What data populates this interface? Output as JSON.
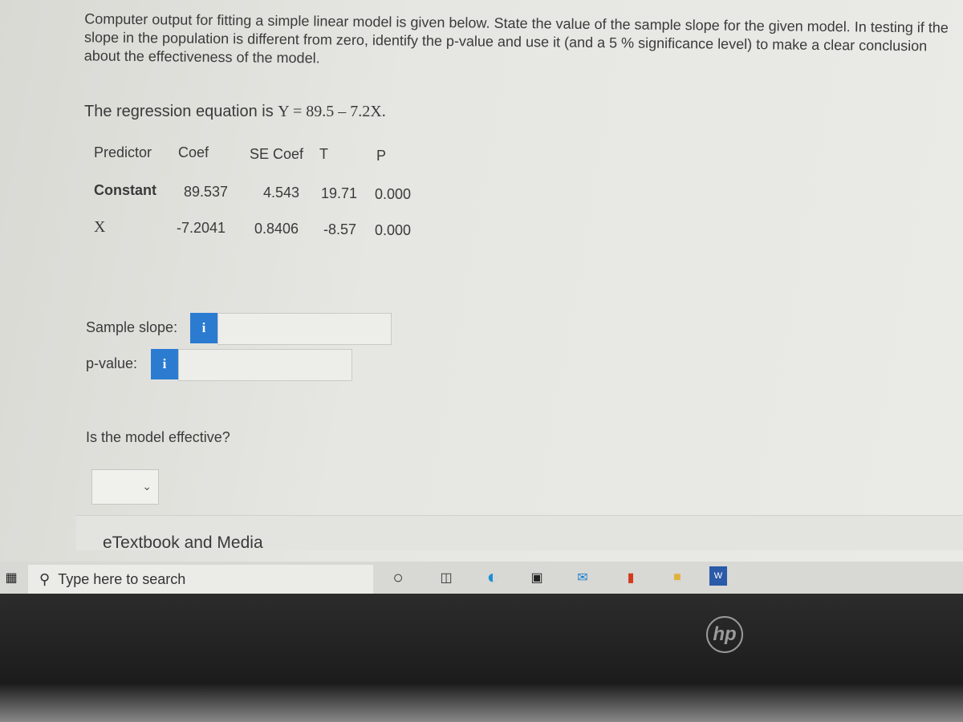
{
  "question": "Computer output for fitting a simple linear model is given below. State the value of the sample slope for the given model. In testing if the slope in the population is different from zero, identify the p-value and use it (and a 5 % significance level) to make a clear conclusion about the effectiveness of the model.",
  "equation": {
    "prefix": "The regression equation is",
    "formula": "Y = 89.5 – 7.2X."
  },
  "table": {
    "headers": [
      "Predictor",
      "Coef",
      "SE Coef",
      "T",
      "P"
    ],
    "rows": [
      [
        "Constant",
        "89.537",
        "4.543",
        "19.71",
        "0.000"
      ],
      [
        "X",
        "-7.2041",
        "0.8406",
        "-8.57",
        "0.000"
      ]
    ]
  },
  "sample_slope": {
    "label": "Sample slope:",
    "value": ""
  },
  "p_value": {
    "label": "p-value:",
    "value": ""
  },
  "info_icon": "i",
  "effective": {
    "label": "Is the model effective?",
    "selected": ""
  },
  "etextbook": "eTextbook and Media",
  "taskbar": {
    "search_placeholder": "Type here to search",
    "word_label": "W"
  },
  "brand": "hp",
  "colors": {
    "info": "#2b7bd1"
  }
}
